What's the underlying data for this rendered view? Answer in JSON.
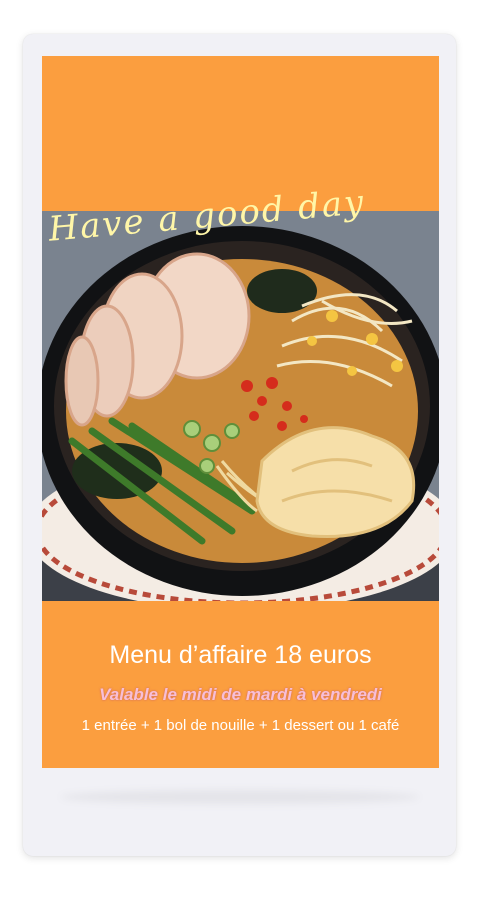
{
  "story": {
    "handwriting": "Have a good day",
    "photo_subject": "ramen-bowl-photo",
    "title": "Menu d’affaire 18 euros",
    "subtitle": "Valable le midi de mardi à vendredi",
    "details": "1 entrée + 1 bol de nouille + 1 dessert ou 1 café"
  },
  "colors": {
    "poster_background": "#fb9e3f",
    "handwriting": "#fff6a8",
    "subtitle": "#f7bfd6",
    "text": "#ffffff",
    "card_background": "#f1f1f6"
  }
}
